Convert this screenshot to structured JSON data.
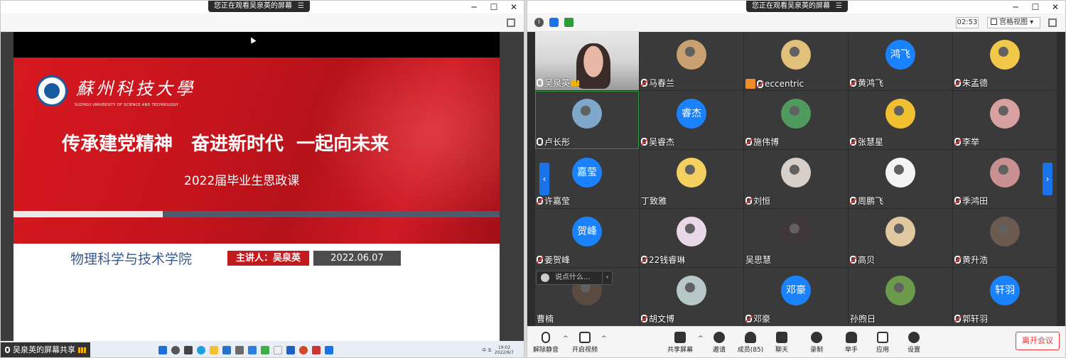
{
  "left_window": {
    "banner": "您正在观看吴泉英的屏幕",
    "slide": {
      "university_cn": "蘇州科技大學",
      "university_en": "SUZHOU UNIVERSITY OF SCIENCE AND TECHNOLOGY",
      "headline": "传承建党精神　奋进新时代  一起向未来",
      "subheadline": "2022届毕业生思政课",
      "college": "物理科学与技术学院",
      "speaker": "主讲人：吴泉英",
      "date": "2022.06.07"
    },
    "taskbar": {
      "share_label": "吴泉英的屏幕共享",
      "tray_text": "中  五",
      "clock_time": "19:02",
      "clock_date": "2022/6/7"
    }
  },
  "right_window": {
    "banner": "您正在观看吴泉英的屏幕",
    "timer": "02:53",
    "view_mode": "宫格视图",
    "participants": [
      {
        "name": "吴泉英",
        "avatar_text": "",
        "mic": "on",
        "signal": true,
        "video": true
      },
      {
        "name": "马春兰",
        "avatar_text": "",
        "mic": "muted",
        "color": "#c9a070"
      },
      {
        "name": "eccentric",
        "avatar_text": "",
        "mic": "muted",
        "color": "#e0c07a",
        "badge": true
      },
      {
        "name": "黄鸿飞",
        "avatar_text": "鸿飞",
        "mic": "muted"
      },
      {
        "name": "朱孟德",
        "avatar_text": "",
        "mic": "muted",
        "color": "#f2c84b"
      },
      {
        "name": "卢长彤",
        "avatar_text": "",
        "mic": "on",
        "color": "#7fa7c9",
        "selected": true
      },
      {
        "name": "吴睿杰",
        "avatar_text": "睿杰",
        "mic": "muted"
      },
      {
        "name": "施伟博",
        "avatar_text": "",
        "mic": "muted",
        "color": "#4f9a5c"
      },
      {
        "name": "张慧星",
        "avatar_text": "",
        "mic": "muted",
        "color": "#f0c030"
      },
      {
        "name": "李举",
        "avatar_text": "",
        "mic": "muted",
        "color": "#d9a0a0"
      },
      {
        "name": "许嘉莹",
        "avatar_text": "嘉莹",
        "mic": "muted"
      },
      {
        "name": "丁致雅",
        "avatar_text": "",
        "mic": "none",
        "color": "#f3d060"
      },
      {
        "name": "刘恒",
        "avatar_text": "",
        "mic": "muted",
        "color": "#d8d0c8"
      },
      {
        "name": "周鹏飞",
        "avatar_text": "",
        "mic": "muted",
        "color": "#f4f4f4"
      },
      {
        "name": "季鸿田",
        "avatar_text": "",
        "mic": "muted",
        "color": "#c89090"
      },
      {
        "name": "姜贺峰",
        "avatar_text": "贺峰",
        "mic": "muted"
      },
      {
        "name": "22钱睿琳",
        "avatar_text": "",
        "mic": "muted",
        "color": "#e8d8e8"
      },
      {
        "name": "吴思慧",
        "avatar_text": "",
        "mic": "none",
        "color": "#403838"
      },
      {
        "name": "高贝",
        "avatar_text": "",
        "mic": "muted",
        "color": "#e0c8a0"
      },
      {
        "name": "黄升浩",
        "avatar_text": "",
        "mic": "muted",
        "color": "#6a5a50"
      },
      {
        "name": "曹楠",
        "avatar_text": "",
        "mic": "none",
        "color": "#5a4a40"
      },
      {
        "name": "胡文博",
        "avatar_text": "",
        "mic": "muted",
        "color": "#b8c8c8"
      },
      {
        "name": "邓豪",
        "avatar_text": "邓豪",
        "mic": "muted"
      },
      {
        "name": "孙煦日",
        "avatar_text": "",
        "mic": "none",
        "color": "#6a9a4a"
      },
      {
        "name": "郭轩羽",
        "avatar_text": "轩羽",
        "mic": "muted"
      }
    ],
    "chat_placeholder": "说点什么...",
    "toolbar": {
      "unmute": "解除静音",
      "start_video": "开启视频",
      "share_screen": "共享屏幕",
      "invite": "邀请",
      "members": "成员(85)",
      "chat": "聊天",
      "record": "录制",
      "raise_hand": "举手",
      "apps": "应用",
      "settings": "设置",
      "leave": "离开会议"
    },
    "colors": {
      "avatar_blue": "#1a82ff",
      "leave_red": "#e33333",
      "nav_blue": "#1a73e8"
    }
  }
}
